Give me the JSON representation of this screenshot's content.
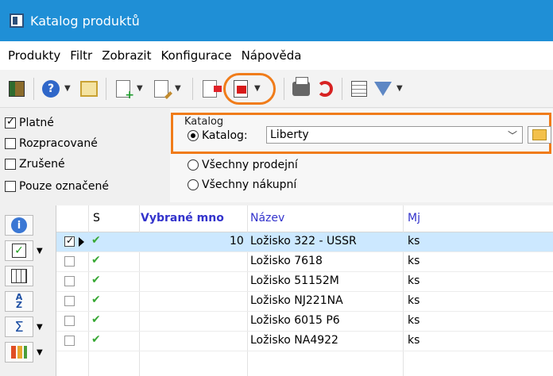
{
  "window": {
    "title": "Katalog produktů"
  },
  "menu": [
    "Produkty",
    "Filtr",
    "Zobrazit",
    "Konfigurace",
    "Nápověda"
  ],
  "toolbar": {
    "icons": [
      "exit-icon",
      "help-icon",
      "tree-icon",
      "new-doc-icon",
      "edit-doc-icon",
      "export-icon",
      "import-icon",
      "print-icon",
      "refresh-icon",
      "list-icon",
      "filter-icon"
    ],
    "highlight_color": "#f07c1a"
  },
  "filters": {
    "checkboxes": [
      {
        "label": "Platné",
        "checked": true
      },
      {
        "label": "Rozpracované",
        "checked": false
      },
      {
        "label": "Zrušené",
        "checked": false
      },
      {
        "label": "Pouze označené",
        "checked": false
      }
    ],
    "catalog_group": {
      "label": "Katalog",
      "radio_catalog": "Katalog:",
      "combo_value": "Liberty",
      "radio_all_sales": "Všechny prodejní",
      "radio_all_purchase": "Všechny nákupní"
    }
  },
  "grid": {
    "columns": [
      "S",
      "Vybrané mno",
      "Název",
      "Mj"
    ],
    "rows": [
      {
        "selected": true,
        "checked": true,
        "qty": "10",
        "name": "Ložisko 322 - USSR",
        "unit": "ks"
      },
      {
        "selected": false,
        "checked": false,
        "qty": "",
        "name": "Ložisko 7618",
        "unit": "ks"
      },
      {
        "selected": false,
        "checked": false,
        "qty": "",
        "name": "Ložisko 51152M",
        "unit": "ks"
      },
      {
        "selected": false,
        "checked": false,
        "qty": "",
        "name": "Ložisko NJ221NA",
        "unit": "ks"
      },
      {
        "selected": false,
        "checked": false,
        "qty": "",
        "name": "Ložisko 6015 P6",
        "unit": "ks"
      },
      {
        "selected": false,
        "checked": false,
        "qty": "",
        "name": "Ložisko NA4922",
        "unit": "ks"
      }
    ]
  },
  "colors": {
    "titlebar": "#1f8fd6",
    "selection": "#cce8ff",
    "accent_orange": "#f07c1a"
  }
}
